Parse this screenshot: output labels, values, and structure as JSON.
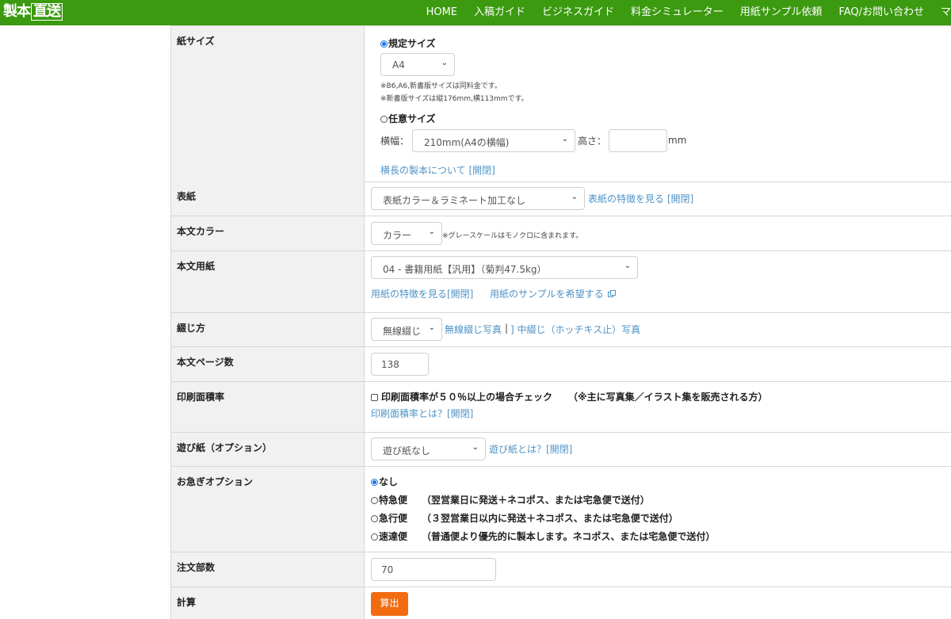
{
  "header": {
    "logo": {
      "main": "製本",
      "boxed": "直送",
      "com": ".com"
    },
    "nav": [
      "HOME",
      "入稿ガイド",
      "ビジネスガイド",
      "料金シミュレーター",
      "用紙サンプル依頼",
      "FAQ/お問い合わせ",
      "マ"
    ]
  },
  "rows": {
    "paper_size": {
      "label": "紙サイズ",
      "standard_option": "規定サイズ",
      "standard_selected": true,
      "size_select": "A4",
      "note1": "※B6,A6,新書版サイズは同料金です。",
      "note2": "※新書版サイズは縦176mm,横113mmです。",
      "custom_option": "任意サイズ",
      "width_label": "横幅：",
      "width_select": "210mm(A4の横幅)",
      "height_label": "高さ：",
      "height_value": "",
      "unit": "mm",
      "link": "横長の製本について [開閉]"
    },
    "cover": {
      "label": "表紙",
      "select": "表紙カラー＆ラミネート加工なし",
      "link": "表紙の特徴を見る [開閉]"
    },
    "body_color": {
      "label": "本文カラー",
      "select": "カラー",
      "note": "※グレースケールはモノクロに含まれます。"
    },
    "body_paper": {
      "label": "本文用紙",
      "select": "04 - 書籍用紙【汎用】（菊判47.5kg）",
      "link1": "用紙の特徴を見る[開閉]",
      "link2": "用紙のサンプルを希望する"
    },
    "binding": {
      "label": "綴じ方",
      "select": "無線綴じ",
      "link1": "無線綴じ写真",
      "separator": "|",
      "link2": "] 中綴じ（ホッチキス止）写真"
    },
    "pages": {
      "label": "本文ページ数",
      "value": "138"
    },
    "print_area": {
      "label": "印刷面積率",
      "checkbox_label": "印刷面積率が５０％以上の場合チェック",
      "checkbox_note": "（※主に写真集／イラスト集を販売される方）",
      "checked": false,
      "link": "印刷面積率とは？[開閉]"
    },
    "endpaper": {
      "label": "遊び紙（オプション）",
      "select": "遊び紙なし",
      "link": "遊び紙とは？[開閉]"
    },
    "rush": {
      "label": "お急ぎオプション",
      "options": [
        {
          "name": "なし",
          "desc": "",
          "selected": true
        },
        {
          "name": "特急便",
          "desc": "（翌営業日に発送＋ネコポス、または宅急便で送付）",
          "selected": false
        },
        {
          "name": "急行便",
          "desc": "（３翌営業日以内に発送＋ネコポス、または宅急便で送付）",
          "selected": false
        },
        {
          "name": "速達便",
          "desc": "（普通便より優先的に製本します。ネコポス、または宅急便で送付）",
          "selected": false
        }
      ]
    },
    "quantity": {
      "label": "注文部数",
      "value": "70"
    },
    "calc": {
      "label": "計算",
      "button": "算出"
    }
  },
  "colors": {
    "header_bg": "#3b9a0f",
    "link": "#4f93c6",
    "button": "#f26b10",
    "label_bg": "#f1f1f1"
  }
}
